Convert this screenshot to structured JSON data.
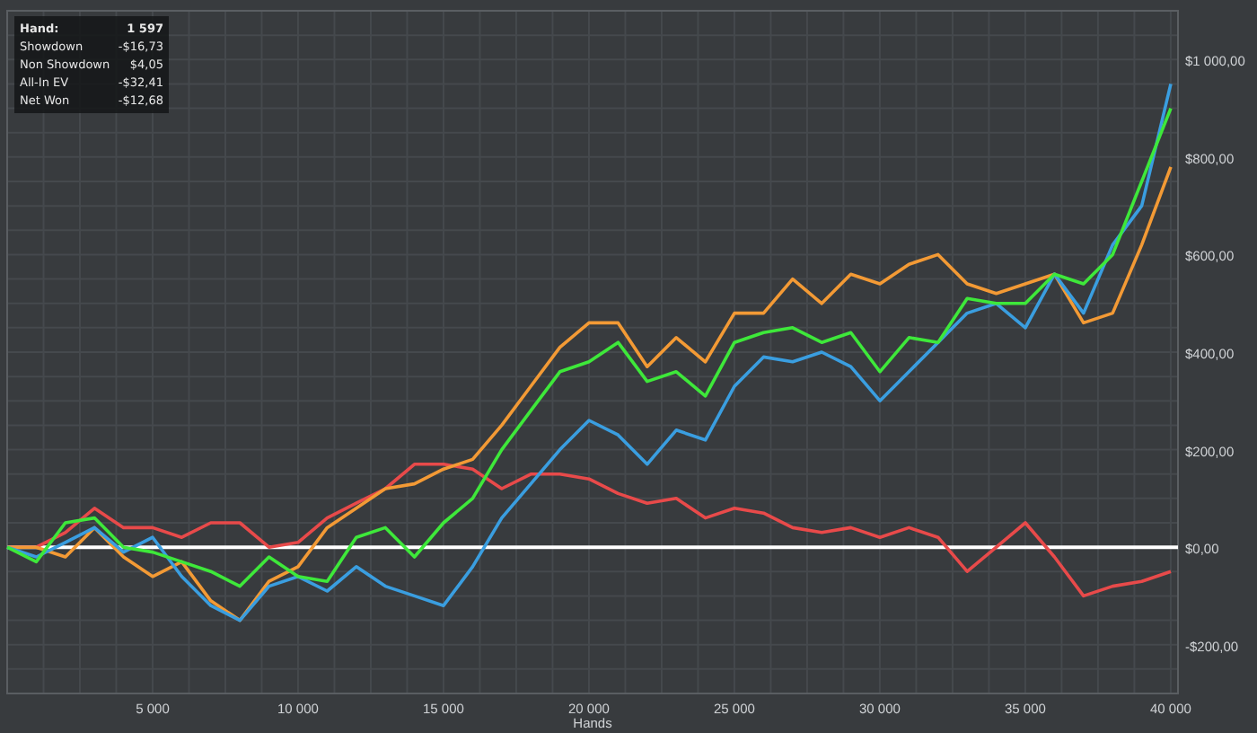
{
  "tooltip": {
    "rows": [
      {
        "label": "Hand:",
        "value": "1 597"
      },
      {
        "label": "Showdown",
        "value": "-$16,73"
      },
      {
        "label": "Non Showdown",
        "value": "$4,05"
      },
      {
        "label": "All-In EV",
        "value": "-$32,41"
      },
      {
        "label": "Net Won",
        "value": "-$12,68"
      }
    ]
  },
  "chart": {
    "chart_data": {
      "type": "line",
      "grid": true,
      "xlabel": "Hands",
      "xlim": [
        0,
        40250
      ],
      "ylim": [
        -300,
        1100
      ],
      "x": [
        0,
        1000,
        2000,
        3000,
        4000,
        5000,
        6000,
        7000,
        8000,
        9000,
        10000,
        11000,
        12000,
        13000,
        14000,
        15000,
        16000,
        17000,
        18000,
        19000,
        20000,
        21000,
        22000,
        23000,
        24000,
        25000,
        26000,
        27000,
        28000,
        29000,
        30000,
        31000,
        32000,
        33000,
        34000,
        35000,
        36000,
        37000,
        38000,
        39000,
        40000
      ],
      "xticks": [
        {
          "value": 5000,
          "label": "5 000"
        },
        {
          "value": 10000,
          "label": "10 000"
        },
        {
          "value": 15000,
          "label": "15 000"
        },
        {
          "value": 20000,
          "label": "20 000"
        },
        {
          "value": 25000,
          "label": "25 000"
        },
        {
          "value": 30000,
          "label": "30 000"
        },
        {
          "value": 35000,
          "label": "35 000"
        },
        {
          "value": 40000,
          "label": "40 000"
        }
      ],
      "yticks": [
        {
          "value": -200,
          "label": "-$200,00"
        },
        {
          "value": 0,
          "label": "$0,00"
        },
        {
          "value": 200,
          "label": "$200,00"
        },
        {
          "value": 400,
          "label": "$400,00"
        },
        {
          "value": 600,
          "label": "$600,00"
        },
        {
          "value": 800,
          "label": "$800,00"
        },
        {
          "value": 1000,
          "label": "$1 000,00"
        }
      ],
      "series": [
        {
          "color": "#e84a4a",
          "values": [
            0,
            0,
            30,
            80,
            40,
            40,
            20,
            50,
            50,
            0,
            10,
            60,
            90,
            120,
            170,
            170,
            160,
            120,
            150,
            150,
            140,
            110,
            90,
            100,
            60,
            80,
            70,
            40,
            30,
            40,
            20,
            40,
            20,
            -50,
            0,
            50,
            -20,
            -100,
            -80,
            -70,
            -50
          ]
        },
        {
          "color": "#f39a35",
          "values": [
            0,
            0,
            -20,
            40,
            -20,
            -60,
            -30,
            -110,
            -150,
            -70,
            -40,
            40,
            80,
            120,
            130,
            160,
            180,
            250,
            330,
            410,
            460,
            460,
            370,
            430,
            380,
            480,
            480,
            550,
            500,
            560,
            540,
            580,
            600,
            540,
            520,
            540,
            560,
            460,
            480,
            620,
            780
          ]
        },
        {
          "color": "#3a9ee0",
          "values": [
            0,
            -20,
            10,
            40,
            -10,
            20,
            -60,
            -120,
            -150,
            -80,
            -60,
            -90,
            -40,
            -80,
            -100,
            -120,
            -40,
            60,
            130,
            200,
            260,
            230,
            170,
            240,
            220,
            330,
            390,
            380,
            400,
            370,
            300,
            360,
            420,
            480,
            500,
            450,
            560,
            480,
            620,
            700,
            950
          ]
        },
        {
          "color": "#3ee83a",
          "values": [
            0,
            -30,
            50,
            60,
            0,
            -10,
            -30,
            -50,
            -80,
            -20,
            -60,
            -70,
            20,
            40,
            -20,
            50,
            100,
            200,
            280,
            360,
            380,
            420,
            340,
            360,
            310,
            420,
            440,
            450,
            420,
            440,
            360,
            430,
            420,
            510,
            500,
            500,
            560,
            540,
            600,
            750,
            900
          ]
        }
      ]
    }
  }
}
